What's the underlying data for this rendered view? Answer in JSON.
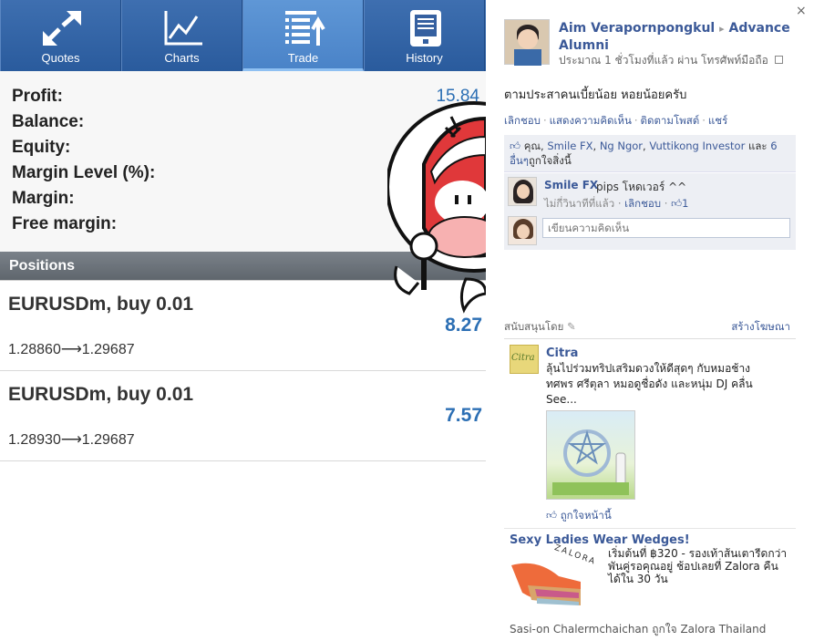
{
  "app": {
    "tabs": [
      {
        "label": "Quotes",
        "icon": "quotes-arrows-icon"
      },
      {
        "label": "Charts",
        "icon": "chart-line-icon"
      },
      {
        "label": "Trade",
        "icon": "trade-list-icon",
        "active": true
      },
      {
        "label": "History",
        "icon": "history-tablet-icon"
      }
    ],
    "summary": {
      "profit_label": "Profit:",
      "profit_value": "15.84",
      "balance_label": "Balance:",
      "equity_label": "Equity:",
      "margin_level_label": "Margin Level (%):",
      "margin_label": "Margin:",
      "free_margin_label": "Free margin:"
    },
    "positions_header": "Positions",
    "positions": [
      {
        "title": "EURUSDm, buy 0.01",
        "profit": "8.27",
        "open_price": "1.28860",
        "current_price": "1.29687"
      },
      {
        "title": "EURUSDm, buy 0.01",
        "profit": "7.57",
        "open_price": "1.28930",
        "current_price": "1.29687"
      }
    ],
    "colors": {
      "nav": "#2a5b9d",
      "value_blue": "#2c6fb4",
      "header_grey": "#6b7279"
    }
  },
  "fb": {
    "close": "×",
    "author": "Aim Verapornpongkul",
    "arrow": "▸",
    "target": "Advance Alumni",
    "meta": "ประมาณ 1 ชั่วโมงที่แล้ว ผ่าน โทรศัพท์มือถือ",
    "post_text": "ตามประสาคนเบี้ยน้อย หอยน้อยครับ",
    "actions": [
      "เลิกชอบ",
      "แสดงความคิดเห็น",
      "ติดตามโพสต์",
      "แชร์"
    ],
    "likes": {
      "prefix": "คุณ,",
      "names": [
        "Smile FX",
        "Ng Ngor",
        "Vuttikong Investor"
      ],
      "joiner": "และ",
      "others": "6 อื่นๆ",
      "suffix": "ถูกใจสิ่งนี้"
    },
    "comment": {
      "name": "Smile FX",
      "text": "pips โหดเวอร์ ^^",
      "time": "ไม่กี่วินาทีที่แล้ว",
      "unlike": "เลิกชอบ",
      "like_count": "1"
    },
    "comment_placeholder": "เขียนความคิดเห็น",
    "sponsored_label": "สนับสนุนโดย",
    "create_ad": "สร้างโฆษณา",
    "ads": [
      {
        "title": "Citra",
        "logo_text": "Citra",
        "body_lines": [
          "ลุ้นไปร่วมทริปเสริมดวงให้ดีสุดๆ กับหมอช้าง",
          "ทศพร ศรีตุลา หมอดูชื่อดัง และหนุ่ม DJ คลื่น",
          "See..."
        ],
        "like": "ถูกใจหน้านี้"
      },
      {
        "title": "Sexy Ladies Wear Wedges!",
        "brand_text": "ZALORA",
        "body_lines": [
          "เริ่มต้นที่ ฿320 - รองเท้าส้นเตารีดกว่า",
          "พันคู่รอคุณอยู่ ช้อปเลยที่ Zalora คืน",
          "ได้ใน 30 วัน"
        ],
        "footer": "Sasi-on Chalermchaichan ถูกใจ Zalora Thailand"
      }
    ]
  }
}
